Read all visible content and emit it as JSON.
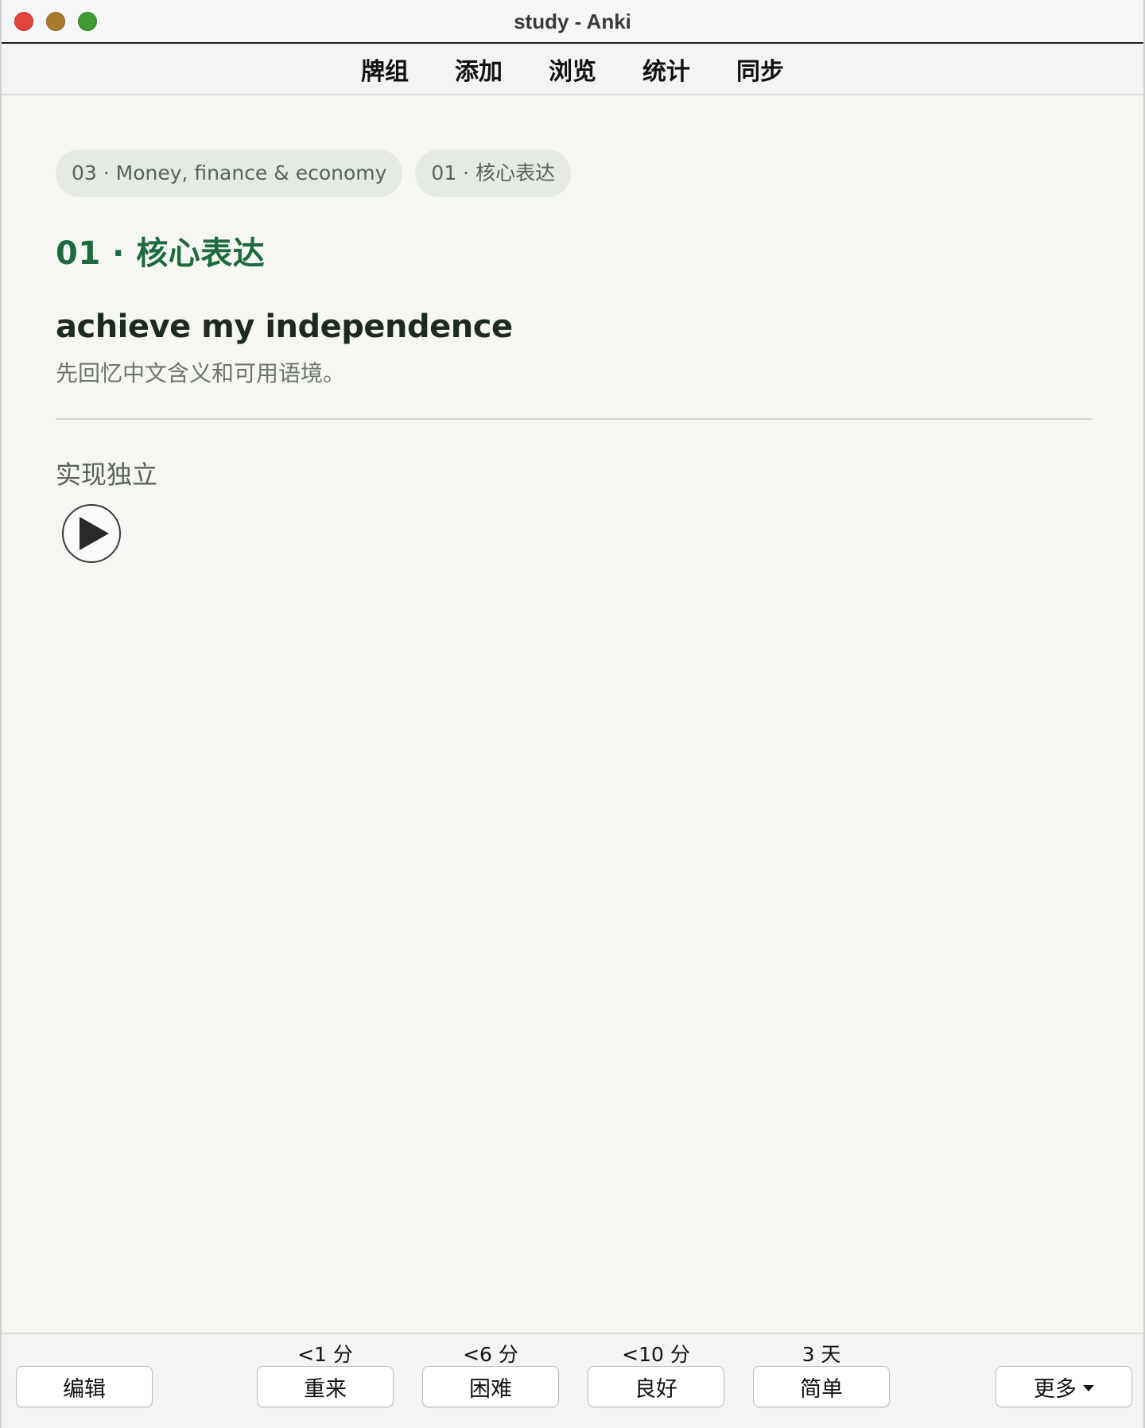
{
  "window": {
    "title": "study - Anki"
  },
  "toolbar": {
    "items": [
      {
        "label": "牌组"
      },
      {
        "label": "添加"
      },
      {
        "label": "浏览"
      },
      {
        "label": "统计"
      },
      {
        "label": "同步"
      }
    ]
  },
  "card": {
    "tags": [
      "03 · Money, finance & economy",
      "01 · 核心表达"
    ],
    "subdeck_title": "01 · 核心表达",
    "front": "achieve my independence",
    "hint": "先回忆中文含义和可用语境。",
    "back": "实现独立",
    "audio_icon": "play-icon"
  },
  "bottom": {
    "edit_label": "编辑",
    "more_label": "更多",
    "answers": [
      {
        "label": "重来",
        "interval": "<1 分"
      },
      {
        "label": "困难",
        "interval": "<6 分"
      },
      {
        "label": "良好",
        "interval": "<10 分"
      },
      {
        "label": "简单",
        "interval": "3 天"
      }
    ]
  },
  "colors": {
    "accent": "#1e6a3f",
    "tag_bg": "#e4ebe4",
    "background": "#f6f7f3"
  }
}
